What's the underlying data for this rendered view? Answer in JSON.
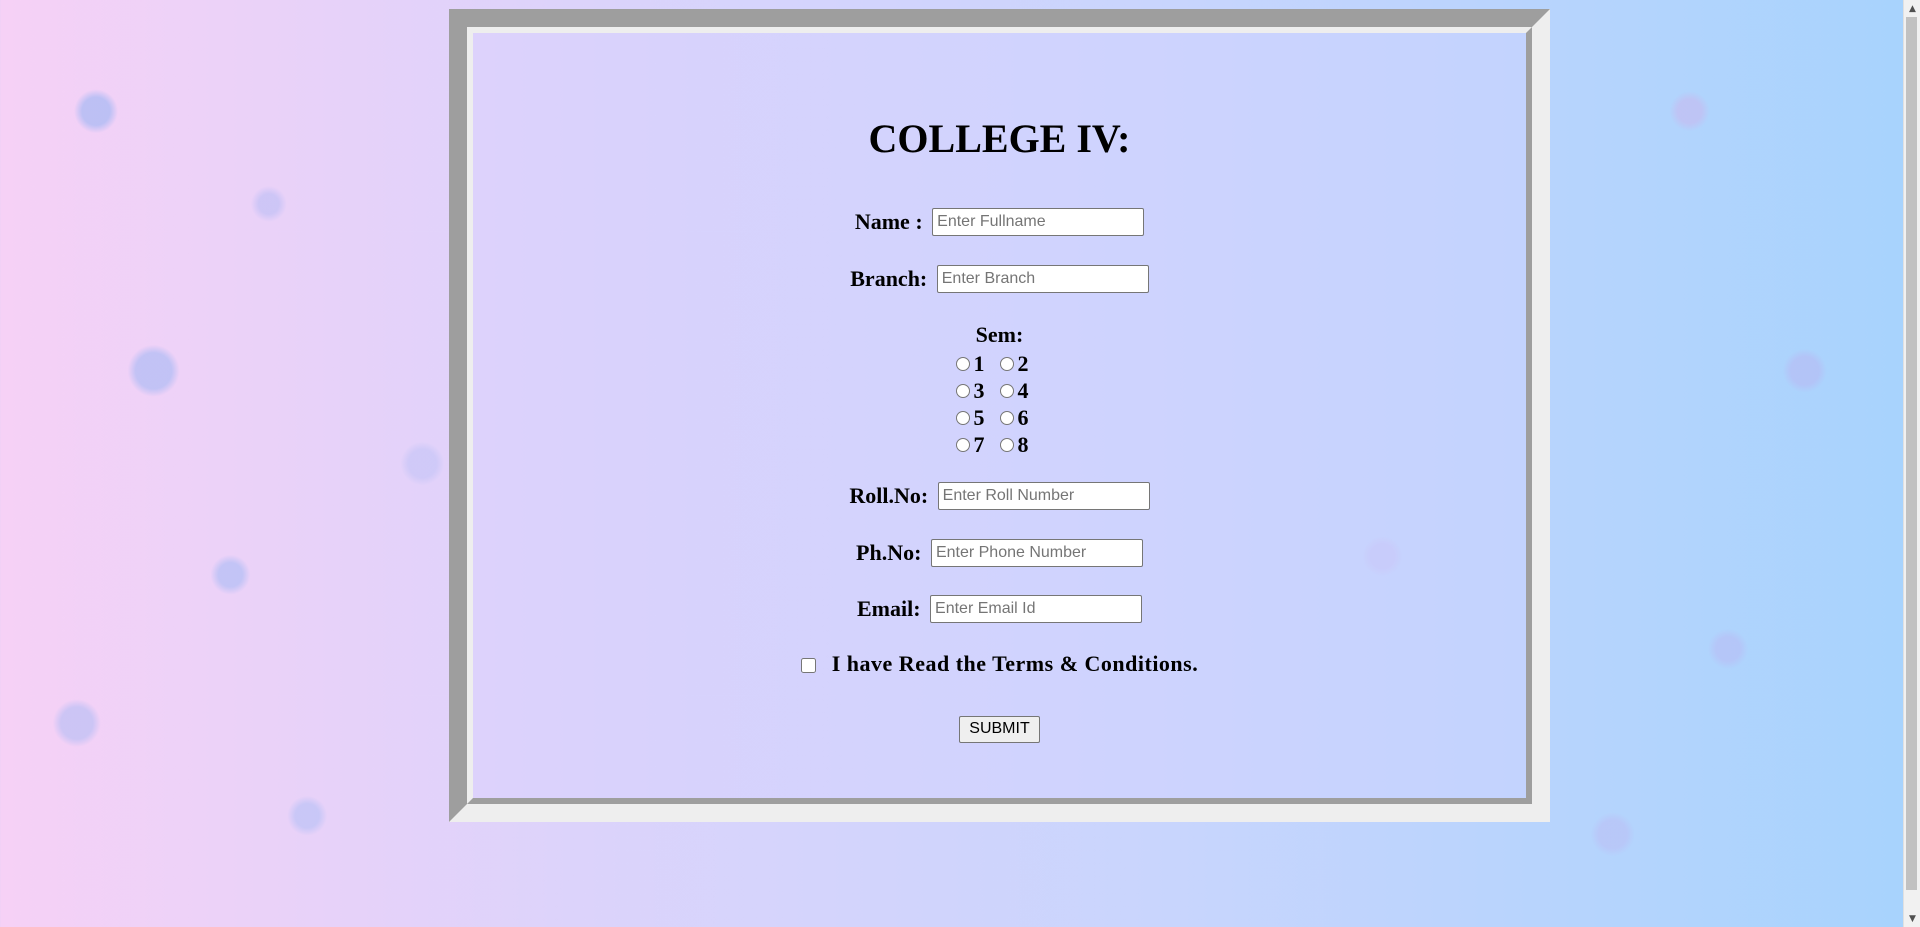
{
  "form": {
    "title": "COLLEGE IV:",
    "name": {
      "label": "Name :",
      "placeholder": "Enter Fullname",
      "value": ""
    },
    "branch": {
      "label": "Branch:",
      "placeholder": "Enter Branch",
      "value": ""
    },
    "sem": {
      "label": "Sem:",
      "options": [
        "1",
        "2",
        "3",
        "4",
        "5",
        "6",
        "7",
        "8"
      ],
      "selected": null
    },
    "roll": {
      "label": "Roll.No:",
      "placeholder": "Enter Roll Number",
      "value": ""
    },
    "phone": {
      "label": "Ph.No:",
      "placeholder": "Enter Phone Number",
      "value": ""
    },
    "email": {
      "label": "Email:",
      "placeholder": "Enter Email Id",
      "value": ""
    },
    "terms": {
      "label": "I have Read the Terms & Conditions.",
      "checked": false
    },
    "submit_label": "SUBMIT"
  },
  "colors": {
    "frame_dark": "#9e9e9e",
    "frame_light": "#eeeeee",
    "bg_left": "#f6d1f6",
    "bg_right": "#a7d3fd"
  }
}
